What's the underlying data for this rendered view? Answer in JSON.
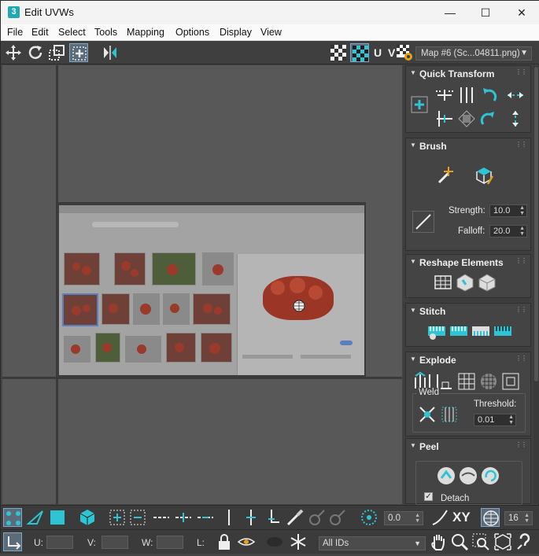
{
  "window": {
    "app_icon": "3",
    "title": "Edit UVWs",
    "controls": {
      "minimize": "—",
      "maximize": "☐",
      "close": "✕"
    }
  },
  "menu": [
    "File",
    "Edit",
    "Select",
    "Tools",
    "Mapping",
    "Options",
    "Display",
    "View"
  ],
  "toolbar": {
    "uv_label": "U V",
    "map_select": "Map #6 (Sc...04811.png)"
  },
  "rollouts": {
    "quick_transform": {
      "title": "Quick Transform"
    },
    "brush": {
      "title": "Brush",
      "strength_label": "Strength:",
      "strength_value": "10.0",
      "falloff_label": "Falloff:",
      "falloff_value": "20.0"
    },
    "reshape": {
      "title": "Reshape Elements"
    },
    "stitch": {
      "title": "Stitch"
    },
    "explode": {
      "title": "Explode",
      "weld_label": "Weld",
      "threshold_label": "Threshold:",
      "threshold_value": "0.01"
    },
    "peel": {
      "title": "Peel",
      "detach_label": "Detach",
      "detach_checked": true
    }
  },
  "bottom": {
    "angle_value": "0.0",
    "xy_label": "XY",
    "grid_value": "16",
    "u_label": "U:",
    "v_label": "V:",
    "w_label": "W:",
    "l_label": "L:",
    "ids_select": "All IDs"
  },
  "colors": {
    "accent": "#2ec4d4",
    "panel": "#444444",
    "viewport": "#585858"
  }
}
